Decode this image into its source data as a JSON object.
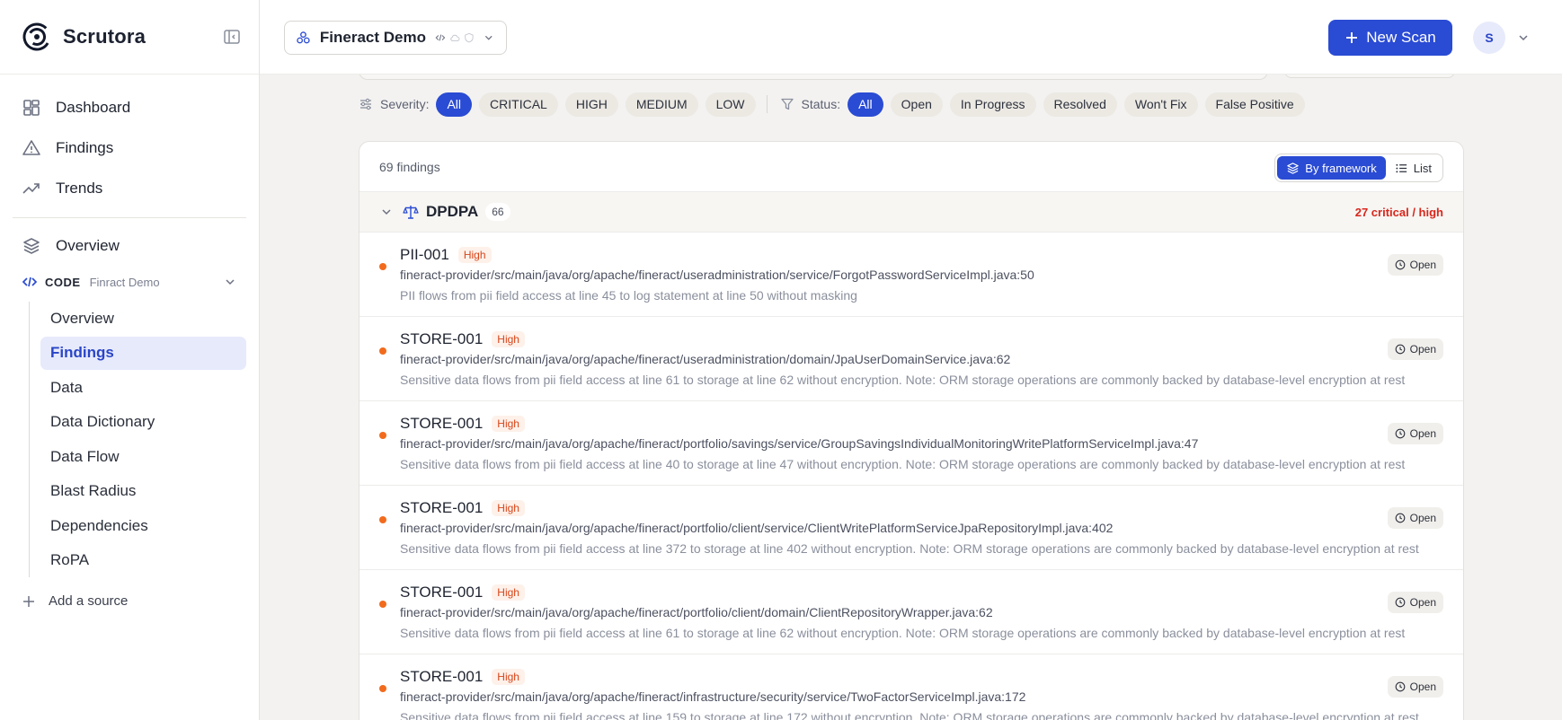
{
  "app": {
    "name": "Scrutora"
  },
  "sidebar": {
    "nav": [
      {
        "label": "Dashboard",
        "icon": "dashboard-icon"
      },
      {
        "label": "Findings",
        "icon": "alert-triangle-icon"
      },
      {
        "label": "Trends",
        "icon": "trend-up-icon"
      }
    ],
    "overview_label": "Overview",
    "source": {
      "type": "CODE",
      "name": "Finract Demo"
    },
    "subnav": [
      {
        "label": "Overview",
        "active": false
      },
      {
        "label": "Findings",
        "active": true
      },
      {
        "label": "Data",
        "active": false
      },
      {
        "label": "Data Dictionary",
        "active": false
      },
      {
        "label": "Data Flow",
        "active": false
      },
      {
        "label": "Blast Radius",
        "active": false
      },
      {
        "label": "Dependencies",
        "active": false
      },
      {
        "label": "RoPA",
        "active": false
      }
    ],
    "add_source_label": "Add a source"
  },
  "topbar": {
    "project": "Fineract Demo",
    "new_scan_label": "New Scan",
    "avatar_initial": "S"
  },
  "filters": {
    "severity_label": "Severity:",
    "severity_options": [
      "All",
      "CRITICAL",
      "HIGH",
      "MEDIUM",
      "LOW"
    ],
    "severity_selected": "All",
    "status_label": "Status:",
    "status_options": [
      "All",
      "Open",
      "In Progress",
      "Resolved",
      "Won't Fix",
      "False Positive"
    ],
    "status_selected": "All"
  },
  "findings": {
    "count_label": "69 findings",
    "view_options": [
      "By framework",
      "List"
    ],
    "view_selected": "By framework",
    "group": {
      "name": "DPDPA",
      "count": "66",
      "critical_label": "27 critical / high"
    },
    "rows": [
      {
        "code": "PII-001",
        "severity": "High",
        "path": "fineract-provider/src/main/java/org/apache/fineract/useradministration/service/ForgotPasswordServiceImpl.java:50",
        "description": "PII flows from pii field access at line 45 to log statement at line 50 without masking",
        "status": "Open"
      },
      {
        "code": "STORE-001",
        "severity": "High",
        "path": "fineract-provider/src/main/java/org/apache/fineract/useradministration/domain/JpaUserDomainService.java:62",
        "description": "Sensitive data flows from pii field access at line 61 to storage at line 62 without encryption. Note: ORM storage operations are commonly backed by database-level encryption at rest",
        "status": "Open"
      },
      {
        "code": "STORE-001",
        "severity": "High",
        "path": "fineract-provider/src/main/java/org/apache/fineract/portfolio/savings/service/GroupSavingsIndividualMonitoringWritePlatformServiceImpl.java:47",
        "description": "Sensitive data flows from pii field access at line 40 to storage at line 47 without encryption. Note: ORM storage operations are commonly backed by database-level encryption at rest",
        "status": "Open"
      },
      {
        "code": "STORE-001",
        "severity": "High",
        "path": "fineract-provider/src/main/java/org/apache/fineract/portfolio/client/service/ClientWritePlatformServiceJpaRepositoryImpl.java:402",
        "description": "Sensitive data flows from pii field access at line 372 to storage at line 402 without encryption. Note: ORM storage operations are commonly backed by database-level encryption at rest",
        "status": "Open"
      },
      {
        "code": "STORE-001",
        "severity": "High",
        "path": "fineract-provider/src/main/java/org/apache/fineract/portfolio/client/domain/ClientRepositoryWrapper.java:62",
        "description": "Sensitive data flows from pii field access at line 61 to storage at line 62 without encryption. Note: ORM storage operations are commonly backed by database-level encryption at rest",
        "status": "Open"
      },
      {
        "code": "STORE-001",
        "severity": "High",
        "path": "fineract-provider/src/main/java/org/apache/fineract/infrastructure/security/service/TwoFactorServiceImpl.java:172",
        "description": "Sensitive data flows from pii field access at line 159 to storage at line 172 without encryption. Note: ORM storage operations are commonly backed by database-level encryption at rest",
        "status": "Open"
      }
    ]
  },
  "colors": {
    "accent": "#2a4bd3",
    "severity_high": "#d9461a",
    "critical_text": "#d9271c",
    "dot": "#f26b1d"
  }
}
